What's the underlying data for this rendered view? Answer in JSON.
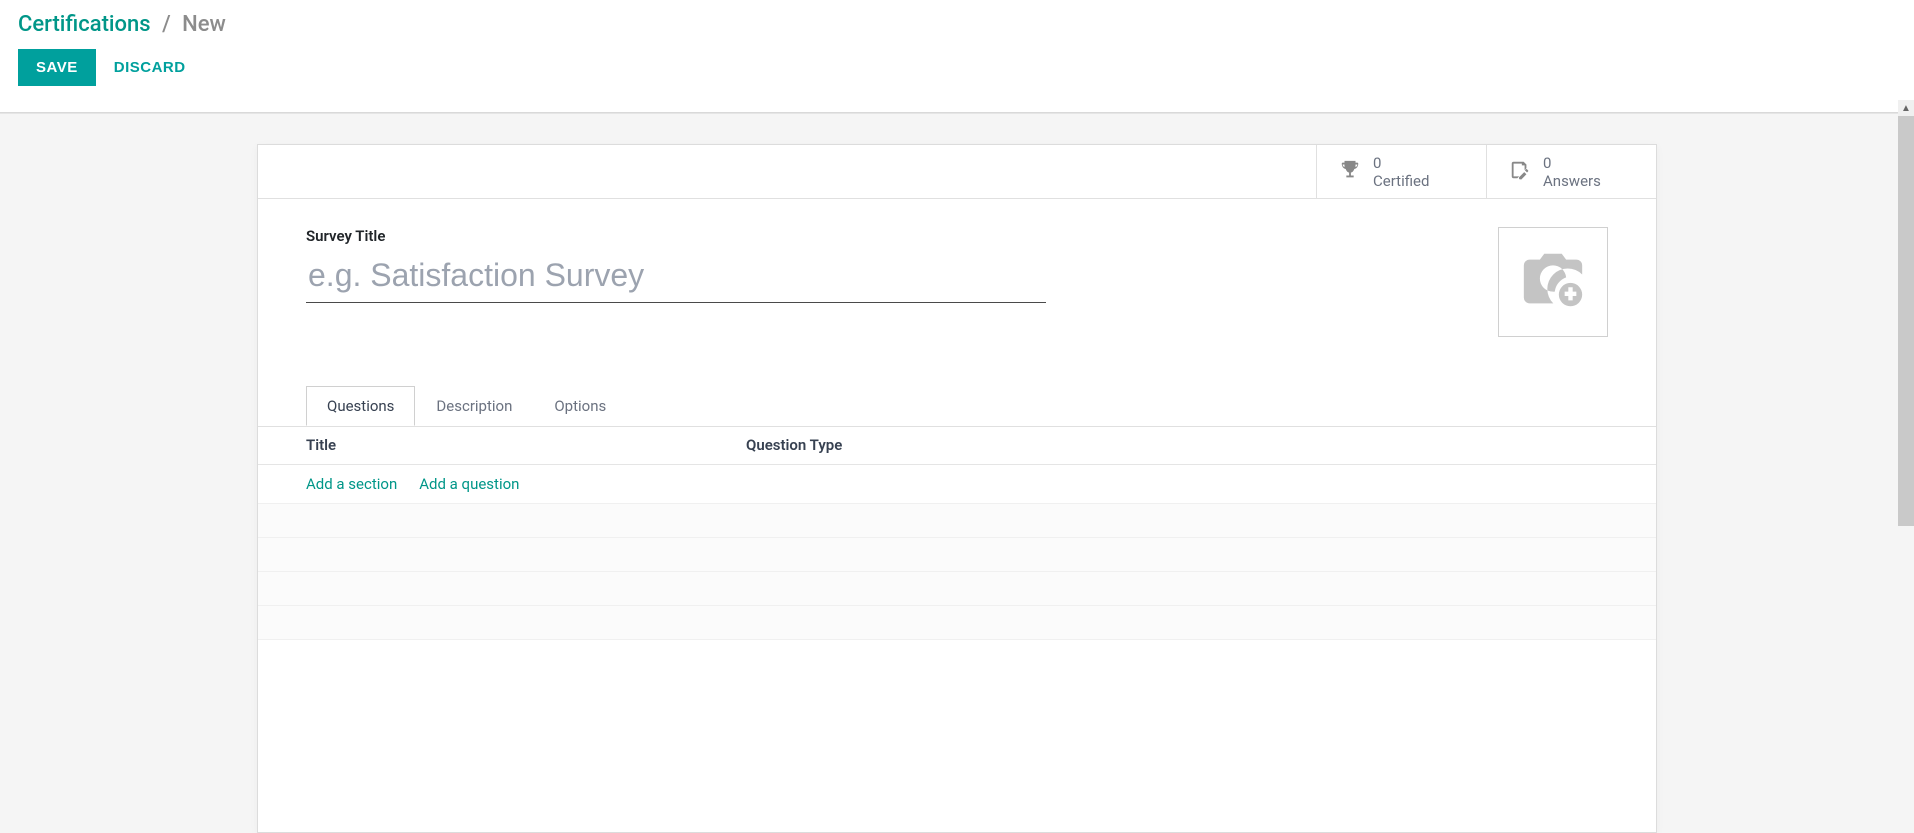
{
  "breadcrumb": {
    "parent": "Certifications",
    "separator": "/",
    "current": "New"
  },
  "actions": {
    "save": "SAVE",
    "discard": "DISCARD"
  },
  "stats": {
    "certified": {
      "count": "0",
      "label": "Certified"
    },
    "answers": {
      "count": "0",
      "label": "Answers"
    }
  },
  "form": {
    "title_label": "Survey Title",
    "title_placeholder": "e.g. Satisfaction Survey",
    "title_value": ""
  },
  "tabs": {
    "questions": "Questions",
    "description": "Description",
    "options": "Options"
  },
  "columns": {
    "title": "Title",
    "type": "Question Type"
  },
  "add_links": {
    "section": "Add a section",
    "question": "Add a question"
  }
}
